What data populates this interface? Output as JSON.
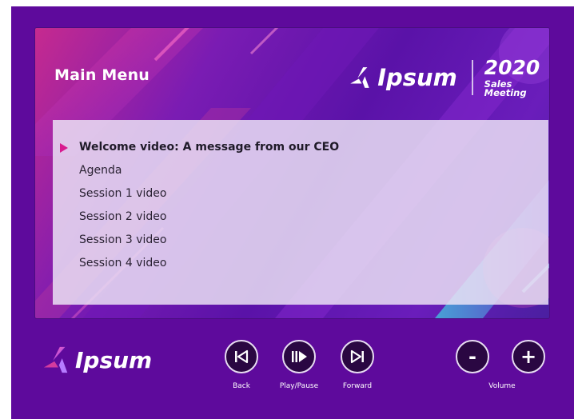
{
  "screen": {
    "title": "Main Menu",
    "brand_name": "Ipsum",
    "brand_year": "2020",
    "brand_subtitle": "Sales Meeting"
  },
  "menu": {
    "items": [
      {
        "label": "Welcome video: A message from our CEO",
        "active": true
      },
      {
        "label": "Agenda",
        "active": false
      },
      {
        "label": "Session 1 video",
        "active": false
      },
      {
        "label": "Session 2 video",
        "active": false
      },
      {
        "label": "Session 3 video",
        "active": false
      },
      {
        "label": "Session 4 video",
        "active": false
      }
    ]
  },
  "footer": {
    "brand_name": "Ipsum",
    "controls": {
      "back_label": "Back",
      "play_pause_label": "Play/Pause",
      "forward_label": "Forward",
      "volume_label": "Volume",
      "volume_down_glyph": "-",
      "volume_up_glyph": "+"
    }
  },
  "colors": {
    "frame_background": "#5e0a9c",
    "accent_pink": "#d81b8f",
    "button_fill": "#2a0742"
  },
  "icons": [
    "back-icon",
    "play-pause-icon",
    "forward-icon",
    "ipsum-logo-icon",
    "menu-arrow-icon"
  ]
}
